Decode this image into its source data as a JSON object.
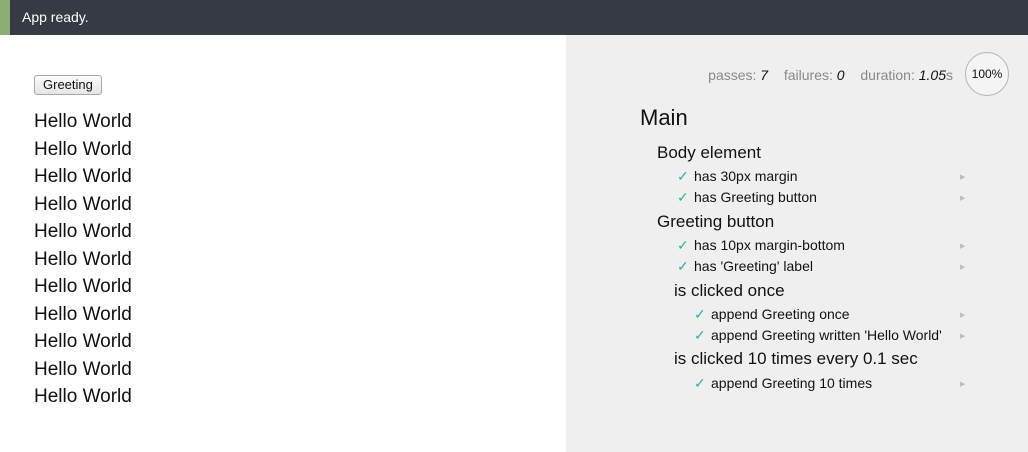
{
  "status_bar": {
    "message": "App ready."
  },
  "app": {
    "button_label": "Greeting",
    "greetings": [
      "Hello World",
      "Hello World",
      "Hello World",
      "Hello World",
      "Hello World",
      "Hello World",
      "Hello World",
      "Hello World",
      "Hello World",
      "Hello World",
      "Hello World"
    ]
  },
  "report": {
    "stats": {
      "passes_label": "passes:",
      "passes": "7",
      "failures_label": "failures:",
      "failures": "0",
      "duration_label": "duration:",
      "duration": "1.05",
      "duration_unit": "s"
    },
    "progress": "100%",
    "root_suite": "Main",
    "suites": [
      {
        "title": "Body element",
        "tests": [
          "has 30px margin",
          "has Greeting button"
        ]
      },
      {
        "title": "Greeting button",
        "tests": [
          "has 10px margin-bottom",
          "has 'Greeting' label"
        ]
      },
      {
        "title": "is clicked once",
        "tests": [
          "append Greeting once",
          "append Greeting written 'Hello World'"
        ]
      },
      {
        "title": "is clicked 10 times every 0.1 sec",
        "tests": [
          "append Greeting 10 times"
        ]
      }
    ],
    "check_glyph": "✓",
    "replay_glyph": "▶"
  },
  "colors": {
    "topbar": "#353a43",
    "topbar_accent": "#8cae74",
    "report_bg": "#efefef",
    "pass_check": "#2bb3a1"
  }
}
